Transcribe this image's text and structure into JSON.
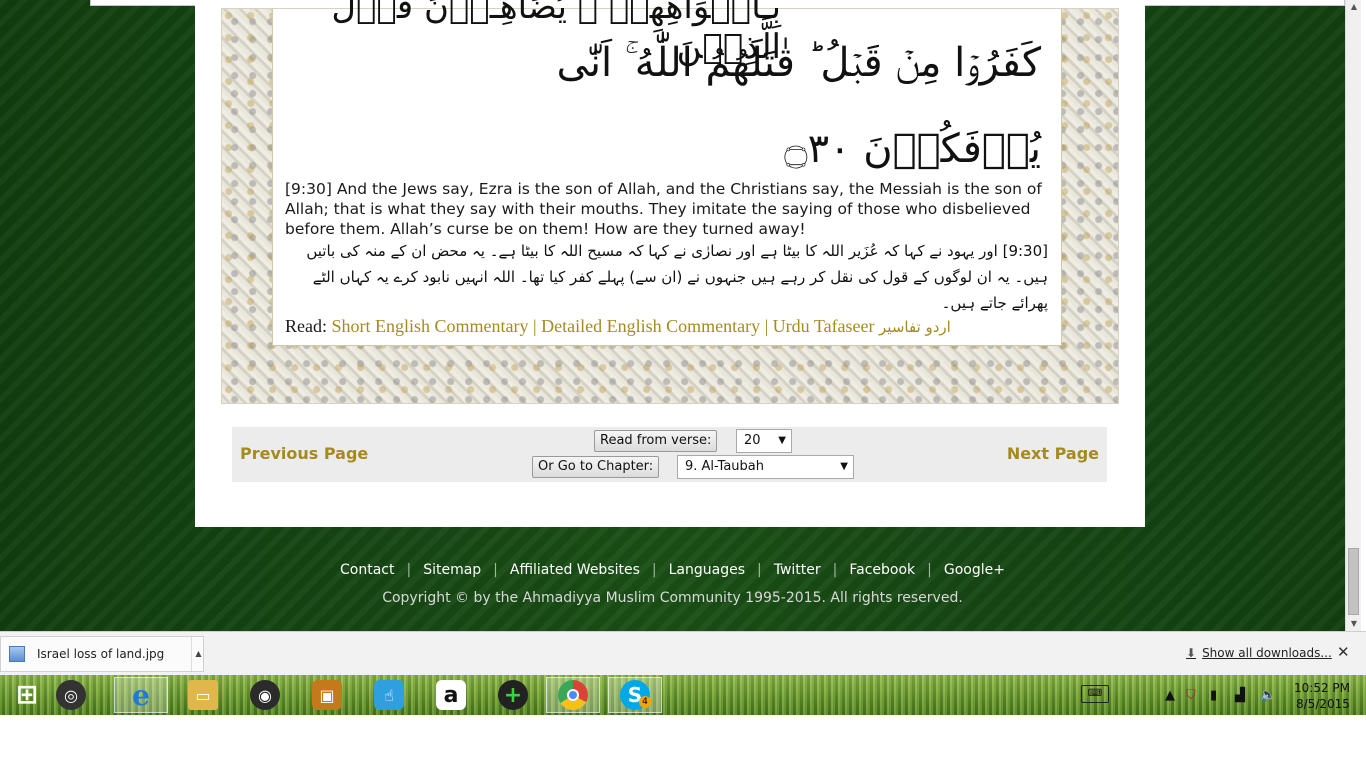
{
  "verse": {
    "arabic_partial": "بِـاَفۡوَاهِهِمۡ ۚ يُضَاهِـُٔوۡنَ قَوۡلَ الَّذِيۡنَ",
    "arabic_line1": "كَفَرُوۡا مِنۡ قَبۡلُ ؕ قٰتَلَهُمُ اللّٰهُ ۚ اَنّٰى",
    "arabic_line2": "يُؤۡفَكُوۡنَ ۝٣٠",
    "english": "[9:30] And the Jews say, Ezra is the son of Allah, and the Christians say, the Messiah is the son of Allah; that is what they say with their mouths. They imitate the saying of those who disbelieved before them. Allah’s curse be on them! How are they turned away!",
    "urdu": "[9:30] اور یہود نے کہا کہ عُزَیر اللہ کا بیٹا ہے اور نصارٰی نے کہا کہ مسیح اللہ کا بیٹا ہے۔ یہ محض ان کے منہ کی باتیں ہیں۔ یہ ان لوگوں کے قول کی نقل کر رہے ہیں جنہوں نے (ان سے) پہلے کفر کیا تھا۔ اللہ انہیں نابود کرے یہ کہاں الٹے پھرائے جاتے ہیں۔"
  },
  "read_links": {
    "prefix": "Read:",
    "short_commentary": "Short English Commentary",
    "detailed_commentary": "Detailed English Commentary",
    "urdu_tafaseer": "Urdu Tafaseer",
    "urdu_tafaseer_native": "اردو تفاسیر",
    "separator": "|"
  },
  "navigation": {
    "previous": "Previous Page",
    "next": "Next Page",
    "read_from_verse_label": "Read from verse:",
    "verse_selected": "20",
    "go_to_chapter_label": "Or Go to Chapter:",
    "chapter_selected": "9. Al-Taubah"
  },
  "footer": {
    "links": [
      "Contact",
      "Sitemap",
      "Affiliated Websites",
      "Languages",
      "Twitter",
      "Facebook",
      "Google+"
    ],
    "copyright": "Copyright © by the Ahmadiyya Muslim Community 1995-2015. All rights reserved."
  },
  "download_bar": {
    "file_name": "Israel loss of land.jpg",
    "show_all": "Show all downloads...",
    "close_symbol": "✕"
  },
  "taskbar": {
    "apps": [
      {
        "name": "start-button",
        "glyph": "⊞",
        "color": "#ffffff"
      },
      {
        "name": "app-circle",
        "glyph": "◎",
        "color": "#333333"
      },
      {
        "name": "internet-explorer",
        "glyph": "e",
        "color": "#1e7ad6"
      },
      {
        "name": "file-explorer",
        "glyph": "▭",
        "color": "#e0b74a"
      },
      {
        "name": "speaker-app",
        "glyph": "◉",
        "color": "#2b2b2b"
      },
      {
        "name": "media-app",
        "glyph": "▣",
        "color": "#c47a1c"
      },
      {
        "name": "touch-app",
        "glyph": "☝",
        "color": "#2f9fe0"
      },
      {
        "name": "amazon",
        "glyph": "a",
        "color": "#ffffff"
      },
      {
        "name": "plus-app",
        "glyph": "+",
        "color": "#2aa02a"
      },
      {
        "name": "chrome",
        "glyph": "◍",
        "color": "#d94436"
      },
      {
        "name": "skype",
        "glyph": "S",
        "color": "#00a8e8"
      }
    ],
    "skype_badge": "4",
    "time": "10:52 PM",
    "date": "8/5/2015"
  }
}
